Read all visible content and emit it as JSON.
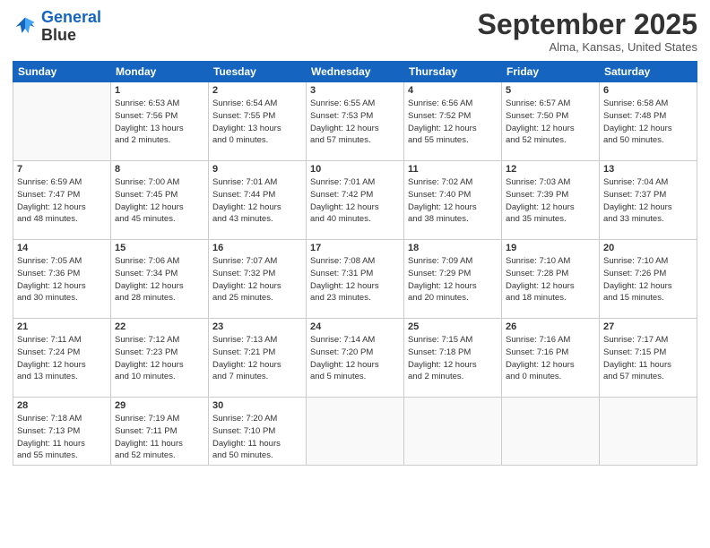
{
  "header": {
    "logo_line1": "General",
    "logo_line2": "Blue",
    "month": "September 2025",
    "location": "Alma, Kansas, United States"
  },
  "weekdays": [
    "Sunday",
    "Monday",
    "Tuesday",
    "Wednesday",
    "Thursday",
    "Friday",
    "Saturday"
  ],
  "weeks": [
    [
      {
        "day": "",
        "info": ""
      },
      {
        "day": "1",
        "info": "Sunrise: 6:53 AM\nSunset: 7:56 PM\nDaylight: 13 hours\nand 2 minutes."
      },
      {
        "day": "2",
        "info": "Sunrise: 6:54 AM\nSunset: 7:55 PM\nDaylight: 13 hours\nand 0 minutes."
      },
      {
        "day": "3",
        "info": "Sunrise: 6:55 AM\nSunset: 7:53 PM\nDaylight: 12 hours\nand 57 minutes."
      },
      {
        "day": "4",
        "info": "Sunrise: 6:56 AM\nSunset: 7:52 PM\nDaylight: 12 hours\nand 55 minutes."
      },
      {
        "day": "5",
        "info": "Sunrise: 6:57 AM\nSunset: 7:50 PM\nDaylight: 12 hours\nand 52 minutes."
      },
      {
        "day": "6",
        "info": "Sunrise: 6:58 AM\nSunset: 7:48 PM\nDaylight: 12 hours\nand 50 minutes."
      }
    ],
    [
      {
        "day": "7",
        "info": "Sunrise: 6:59 AM\nSunset: 7:47 PM\nDaylight: 12 hours\nand 48 minutes."
      },
      {
        "day": "8",
        "info": "Sunrise: 7:00 AM\nSunset: 7:45 PM\nDaylight: 12 hours\nand 45 minutes."
      },
      {
        "day": "9",
        "info": "Sunrise: 7:01 AM\nSunset: 7:44 PM\nDaylight: 12 hours\nand 43 minutes."
      },
      {
        "day": "10",
        "info": "Sunrise: 7:01 AM\nSunset: 7:42 PM\nDaylight: 12 hours\nand 40 minutes."
      },
      {
        "day": "11",
        "info": "Sunrise: 7:02 AM\nSunset: 7:40 PM\nDaylight: 12 hours\nand 38 minutes."
      },
      {
        "day": "12",
        "info": "Sunrise: 7:03 AM\nSunset: 7:39 PM\nDaylight: 12 hours\nand 35 minutes."
      },
      {
        "day": "13",
        "info": "Sunrise: 7:04 AM\nSunset: 7:37 PM\nDaylight: 12 hours\nand 33 minutes."
      }
    ],
    [
      {
        "day": "14",
        "info": "Sunrise: 7:05 AM\nSunset: 7:36 PM\nDaylight: 12 hours\nand 30 minutes."
      },
      {
        "day": "15",
        "info": "Sunrise: 7:06 AM\nSunset: 7:34 PM\nDaylight: 12 hours\nand 28 minutes."
      },
      {
        "day": "16",
        "info": "Sunrise: 7:07 AM\nSunset: 7:32 PM\nDaylight: 12 hours\nand 25 minutes."
      },
      {
        "day": "17",
        "info": "Sunrise: 7:08 AM\nSunset: 7:31 PM\nDaylight: 12 hours\nand 23 minutes."
      },
      {
        "day": "18",
        "info": "Sunrise: 7:09 AM\nSunset: 7:29 PM\nDaylight: 12 hours\nand 20 minutes."
      },
      {
        "day": "19",
        "info": "Sunrise: 7:10 AM\nSunset: 7:28 PM\nDaylight: 12 hours\nand 18 minutes."
      },
      {
        "day": "20",
        "info": "Sunrise: 7:10 AM\nSunset: 7:26 PM\nDaylight: 12 hours\nand 15 minutes."
      }
    ],
    [
      {
        "day": "21",
        "info": "Sunrise: 7:11 AM\nSunset: 7:24 PM\nDaylight: 12 hours\nand 13 minutes."
      },
      {
        "day": "22",
        "info": "Sunrise: 7:12 AM\nSunset: 7:23 PM\nDaylight: 12 hours\nand 10 minutes."
      },
      {
        "day": "23",
        "info": "Sunrise: 7:13 AM\nSunset: 7:21 PM\nDaylight: 12 hours\nand 7 minutes."
      },
      {
        "day": "24",
        "info": "Sunrise: 7:14 AM\nSunset: 7:20 PM\nDaylight: 12 hours\nand 5 minutes."
      },
      {
        "day": "25",
        "info": "Sunrise: 7:15 AM\nSunset: 7:18 PM\nDaylight: 12 hours\nand 2 minutes."
      },
      {
        "day": "26",
        "info": "Sunrise: 7:16 AM\nSunset: 7:16 PM\nDaylight: 12 hours\nand 0 minutes."
      },
      {
        "day": "27",
        "info": "Sunrise: 7:17 AM\nSunset: 7:15 PM\nDaylight: 11 hours\nand 57 minutes."
      }
    ],
    [
      {
        "day": "28",
        "info": "Sunrise: 7:18 AM\nSunset: 7:13 PM\nDaylight: 11 hours\nand 55 minutes."
      },
      {
        "day": "29",
        "info": "Sunrise: 7:19 AM\nSunset: 7:11 PM\nDaylight: 11 hours\nand 52 minutes."
      },
      {
        "day": "30",
        "info": "Sunrise: 7:20 AM\nSunset: 7:10 PM\nDaylight: 11 hours\nand 50 minutes."
      },
      {
        "day": "",
        "info": ""
      },
      {
        "day": "",
        "info": ""
      },
      {
        "day": "",
        "info": ""
      },
      {
        "day": "",
        "info": ""
      }
    ]
  ]
}
